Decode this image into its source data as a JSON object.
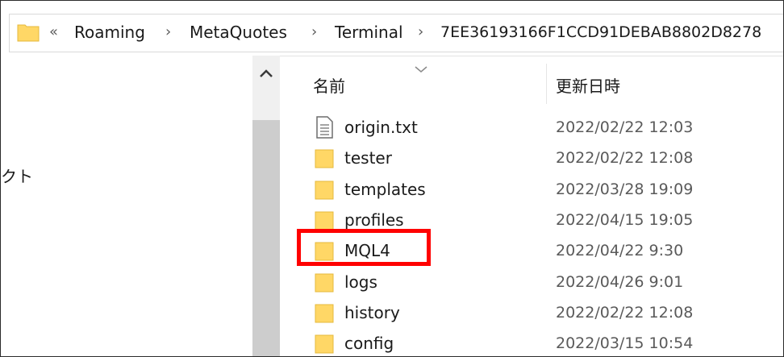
{
  "address": {
    "overflow": "«",
    "crumbs": [
      "Roaming",
      "MetaQuotes",
      "Terminal",
      "7EE36193166F1CCD91DEBAB8802D8278"
    ],
    "separator": "›"
  },
  "nav": {
    "partial_item": "クト"
  },
  "columns": {
    "name": "名前",
    "date": "更新日時"
  },
  "files": [
    {
      "name": "origin.txt",
      "date": "2022/02/22 12:03",
      "icon": "text-file-icon"
    },
    {
      "name": "tester",
      "date": "2022/02/22 12:08",
      "icon": "folder-icon"
    },
    {
      "name": "templates",
      "date": "2022/03/28 19:09",
      "icon": "folder-icon"
    },
    {
      "name": "profiles",
      "date": "2022/04/15 19:05",
      "icon": "folder-icon"
    },
    {
      "name": "MQL4",
      "date": "2022/04/22 9:30",
      "icon": "folder-icon"
    },
    {
      "name": "logs",
      "date": "2022/04/26 9:01",
      "icon": "folder-icon"
    },
    {
      "name": "history",
      "date": "2022/02/22 12:08",
      "icon": "folder-icon"
    },
    {
      "name": "config",
      "date": "2022/03/15 10:54",
      "icon": "folder-icon"
    }
  ],
  "colors": {
    "folder": "#ffd766",
    "folder_dark": "#e5b93c",
    "highlight": "#ff0000"
  }
}
